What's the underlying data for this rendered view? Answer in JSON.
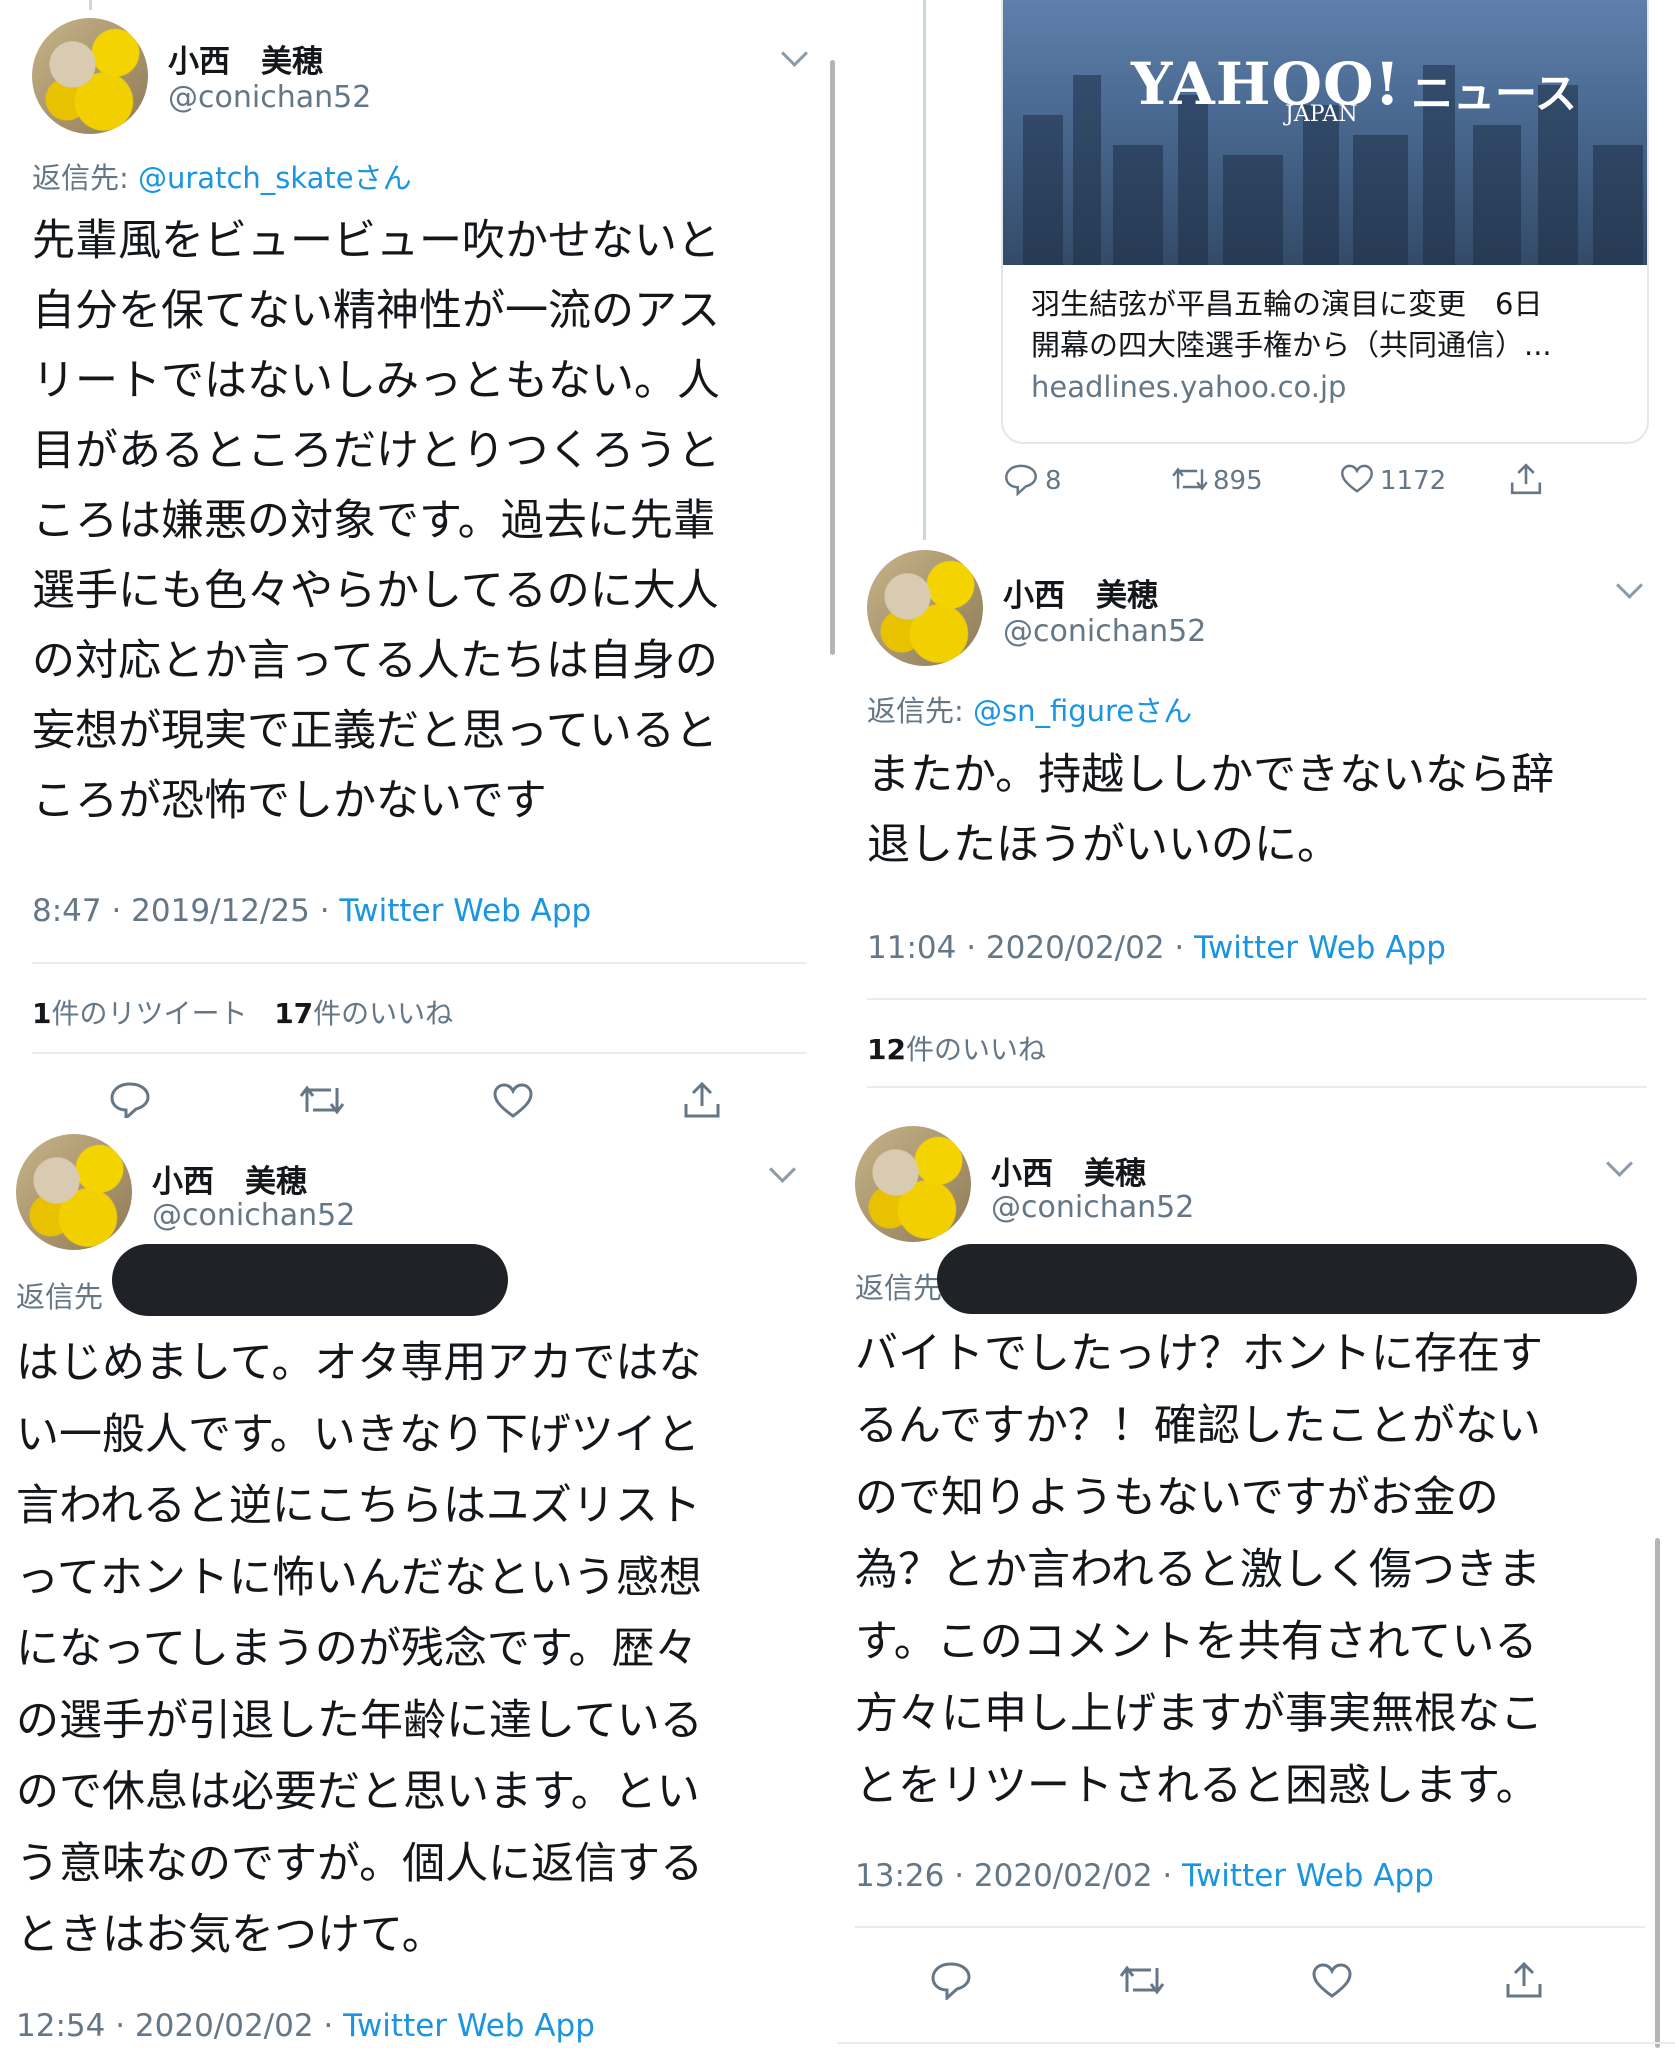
{
  "tweet1": {
    "name": "小西　美穂",
    "handle": "@conichan52",
    "reply_prefix": "返信先: ",
    "reply_to": "@uratch_skateさん",
    "lines": [
      "先輩風をビュービュー吹かせないと",
      "自分を保てない精神性が一流のアス",
      "リートではないしみっともない。人",
      "目があるところだけとりつくろうと",
      "ころは嫌悪の対象です。過去に先輩",
      "選手にも色々やらかしてるのに大人",
      "の対応とか言ってる人たちは自身の",
      "妄想が現実で正義だと思っていると",
      "ころが恐怖でしかないです"
    ],
    "time": "8:47 · 2019/12/25 · ",
    "app": "Twitter Web App",
    "retweet_count": "1",
    "retweet_label": "件のリツイート",
    "like_count": "17",
    "like_label": "件のいいね"
  },
  "tweet2": {
    "card": {
      "logo": "YAHOO!",
      "logo_suffix": "ニュース",
      "logo_sub": "JAPAN",
      "title_lines": [
        "羽生結弦が平昌五輪の演目に変更　6日",
        "開幕の四大陸選手権から（共同通信）..."
      ],
      "domain": "headlines.yahoo.co.jp"
    },
    "reply_count": "8",
    "retweet_count": "895",
    "like_count": "1172"
  },
  "tweet3": {
    "name": "小西　美穂",
    "handle": "@conichan52",
    "reply_prefix": "返信先: ",
    "reply_to": "@sn_figureさん",
    "lines": [
      "またか。持越ししかできないなら辞",
      "退したほうがいいのに。"
    ],
    "time": "11:04 · 2020/02/02 · ",
    "app": "Twitter Web App",
    "like_count": "12",
    "like_label": "件のいいね"
  },
  "tweet4": {
    "name": "小西　美穂",
    "handle": "@conichan52",
    "reply_prefix": "返信先",
    "lines": [
      "はじめまして。オタ専用アカではな",
      "い一般人です。いきなり下げツイと",
      "言われると逆にこちらはユズリスト",
      "ってホントに怖いんだなという感想",
      "になってしまうのが残念です。歴々",
      "の選手が引退した年齢に達している",
      "ので休息は必要だと思います。とい",
      "う意味なのですが。個人に返信する",
      "ときはお気をつけて。"
    ],
    "time": "12:54 · 2020/02/02 · ",
    "app": "Twitter Web App"
  },
  "tweet5": {
    "name": "小西　美穂",
    "handle": "@conichan52",
    "reply_prefix": "返信先",
    "lines": [
      "バイトでしたっけ？ホントに存在す",
      "るんですか？！確認したことがない",
      "ので知りようもないですがお金の",
      "為？とか言われると激しく傷つきま",
      "す。このコメントを共有されている",
      "方々に申し上げますが事実無根なこ",
      "とをリツートされると困惑します。"
    ],
    "time": "13:26 · 2020/02/02 · ",
    "app": "Twitter Web App"
  }
}
